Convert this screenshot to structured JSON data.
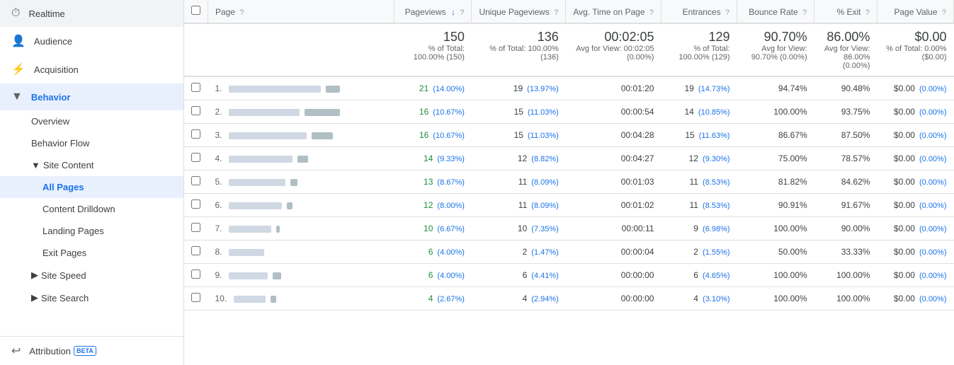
{
  "sidebar": {
    "realtime_label": "Realtime",
    "audience_label": "Audience",
    "acquisition_label": "Acquisition",
    "behavior_label": "Behavior",
    "overview_label": "Overview",
    "behavior_flow_label": "Behavior Flow",
    "site_content_label": "Site Content",
    "all_pages_label": "All Pages",
    "content_drilldown_label": "Content Drilldown",
    "landing_pages_label": "Landing Pages",
    "exit_pages_label": "Exit Pages",
    "site_speed_label": "Site Speed",
    "site_search_label": "Site Search",
    "attribution_label": "Attribution",
    "beta_label": "BETA"
  },
  "table": {
    "columns": {
      "page": "Page",
      "pageviews": "Pageviews",
      "unique_pageviews": "Unique Pageviews",
      "avg_time": "Avg. Time on Page",
      "entrances": "Entrances",
      "bounce_rate": "Bounce Rate",
      "pct_exit": "% Exit",
      "page_value": "Page Value"
    },
    "summary": {
      "pageviews_val": "150",
      "pageviews_sub": "% of Total: 100.00% (150)",
      "unique_pv_val": "136",
      "unique_pv_sub": "% of Total: 100.00% (136)",
      "avg_time_val": "00:02:05",
      "avg_time_sub": "Avg for View: 00:02:05 (0.00%)",
      "entrances_val": "129",
      "entrances_sub": "% of Total: 100.00% (129)",
      "bounce_rate_val": "90.70%",
      "bounce_rate_sub": "Avg for View: 90.70% (0.00%)",
      "pct_exit_val": "86.00%",
      "pct_exit_sub": "Avg for View: 86.00% (0.00%)",
      "page_value_val": "$0.00",
      "page_value_sub": "% of Total: 0.00% ($0.00)"
    },
    "rows": [
      {
        "num": "1.",
        "bar1": 130,
        "bar2": 20,
        "pv": "21",
        "pv_pct": "(14.00%)",
        "upv": "19",
        "upv_pct": "(13.97%)",
        "avg_time": "00:01:20",
        "entr": "19",
        "entr_pct": "(14.73%)",
        "bounce": "94.74%",
        "exit": "90.48%",
        "dollar": "$0.00",
        "dollar_pct": "(0.00%)"
      },
      {
        "num": "2.",
        "bar1": 100,
        "bar2": 50,
        "pv": "16",
        "pv_pct": "(10.67%)",
        "upv": "15",
        "upv_pct": "(11.03%)",
        "avg_time": "00:00:54",
        "entr": "14",
        "entr_pct": "(10.85%)",
        "bounce": "100.00%",
        "exit": "93.75%",
        "dollar": "$0.00",
        "dollar_pct": "(0.00%)"
      },
      {
        "num": "3.",
        "bar1": 110,
        "bar2": 30,
        "pv": "16",
        "pv_pct": "(10.67%)",
        "upv": "15",
        "upv_pct": "(11.03%)",
        "avg_time": "00:04:28",
        "entr": "15",
        "entr_pct": "(11.63%)",
        "bounce": "86.67%",
        "exit": "87.50%",
        "dollar": "$0.00",
        "dollar_pct": "(0.00%)"
      },
      {
        "num": "4.",
        "bar1": 90,
        "bar2": 15,
        "pv": "14",
        "pv_pct": "(9.33%)",
        "upv": "12",
        "upv_pct": "(8.82%)",
        "avg_time": "00:04:27",
        "entr": "12",
        "entr_pct": "(9.30%)",
        "bounce": "75.00%",
        "exit": "78.57%",
        "dollar": "$0.00",
        "dollar_pct": "(0.00%)"
      },
      {
        "num": "5.",
        "bar1": 80,
        "bar2": 10,
        "pv": "13",
        "pv_pct": "(8.67%)",
        "upv": "11",
        "upv_pct": "(8.09%)",
        "avg_time": "00:01:03",
        "entr": "11",
        "entr_pct": "(8.53%)",
        "bounce": "81.82%",
        "exit": "84.62%",
        "dollar": "$0.00",
        "dollar_pct": "(0.00%)"
      },
      {
        "num": "6.",
        "bar1": 75,
        "bar2": 8,
        "pv": "12",
        "pv_pct": "(8.00%)",
        "upv": "11",
        "upv_pct": "(8.09%)",
        "avg_time": "00:01:02",
        "entr": "11",
        "entr_pct": "(8.53%)",
        "bounce": "90.91%",
        "exit": "91.67%",
        "dollar": "$0.00",
        "dollar_pct": "(0.00%)"
      },
      {
        "num": "7.",
        "bar1": 60,
        "bar2": 5,
        "pv": "10",
        "pv_pct": "(6.67%)",
        "upv": "10",
        "upv_pct": "(7.35%)",
        "avg_time": "00:00:11",
        "entr": "9",
        "entr_pct": "(6.98%)",
        "bounce": "100.00%",
        "exit": "90.00%",
        "dollar": "$0.00",
        "dollar_pct": "(0.00%)"
      },
      {
        "num": "8.",
        "bar1": 50,
        "bar2": 0,
        "pv": "6",
        "pv_pct": "(4.00%)",
        "upv": "2",
        "upv_pct": "(1.47%)",
        "avg_time": "00:00:04",
        "entr": "2",
        "entr_pct": "(1.55%)",
        "bounce": "50.00%",
        "exit": "33.33%",
        "dollar": "$0.00",
        "dollar_pct": "(0.00%)"
      },
      {
        "num": "9.",
        "bar1": 55,
        "bar2": 12,
        "pv": "6",
        "pv_pct": "(4.00%)",
        "upv": "6",
        "upv_pct": "(4.41%)",
        "avg_time": "00:00:00",
        "entr": "6",
        "entr_pct": "(4.65%)",
        "bounce": "100.00%",
        "exit": "100.00%",
        "dollar": "$0.00",
        "dollar_pct": "(0.00%)"
      },
      {
        "num": "10.",
        "bar1": 45,
        "bar2": 8,
        "pv": "4",
        "pv_pct": "(2.67%)",
        "upv": "4",
        "upv_pct": "(2.94%)",
        "avg_time": "00:00:00",
        "entr": "4",
        "entr_pct": "(3.10%)",
        "bounce": "100.00%",
        "exit": "100.00%",
        "dollar": "$0.00",
        "dollar_pct": "(0.00%)"
      }
    ]
  }
}
